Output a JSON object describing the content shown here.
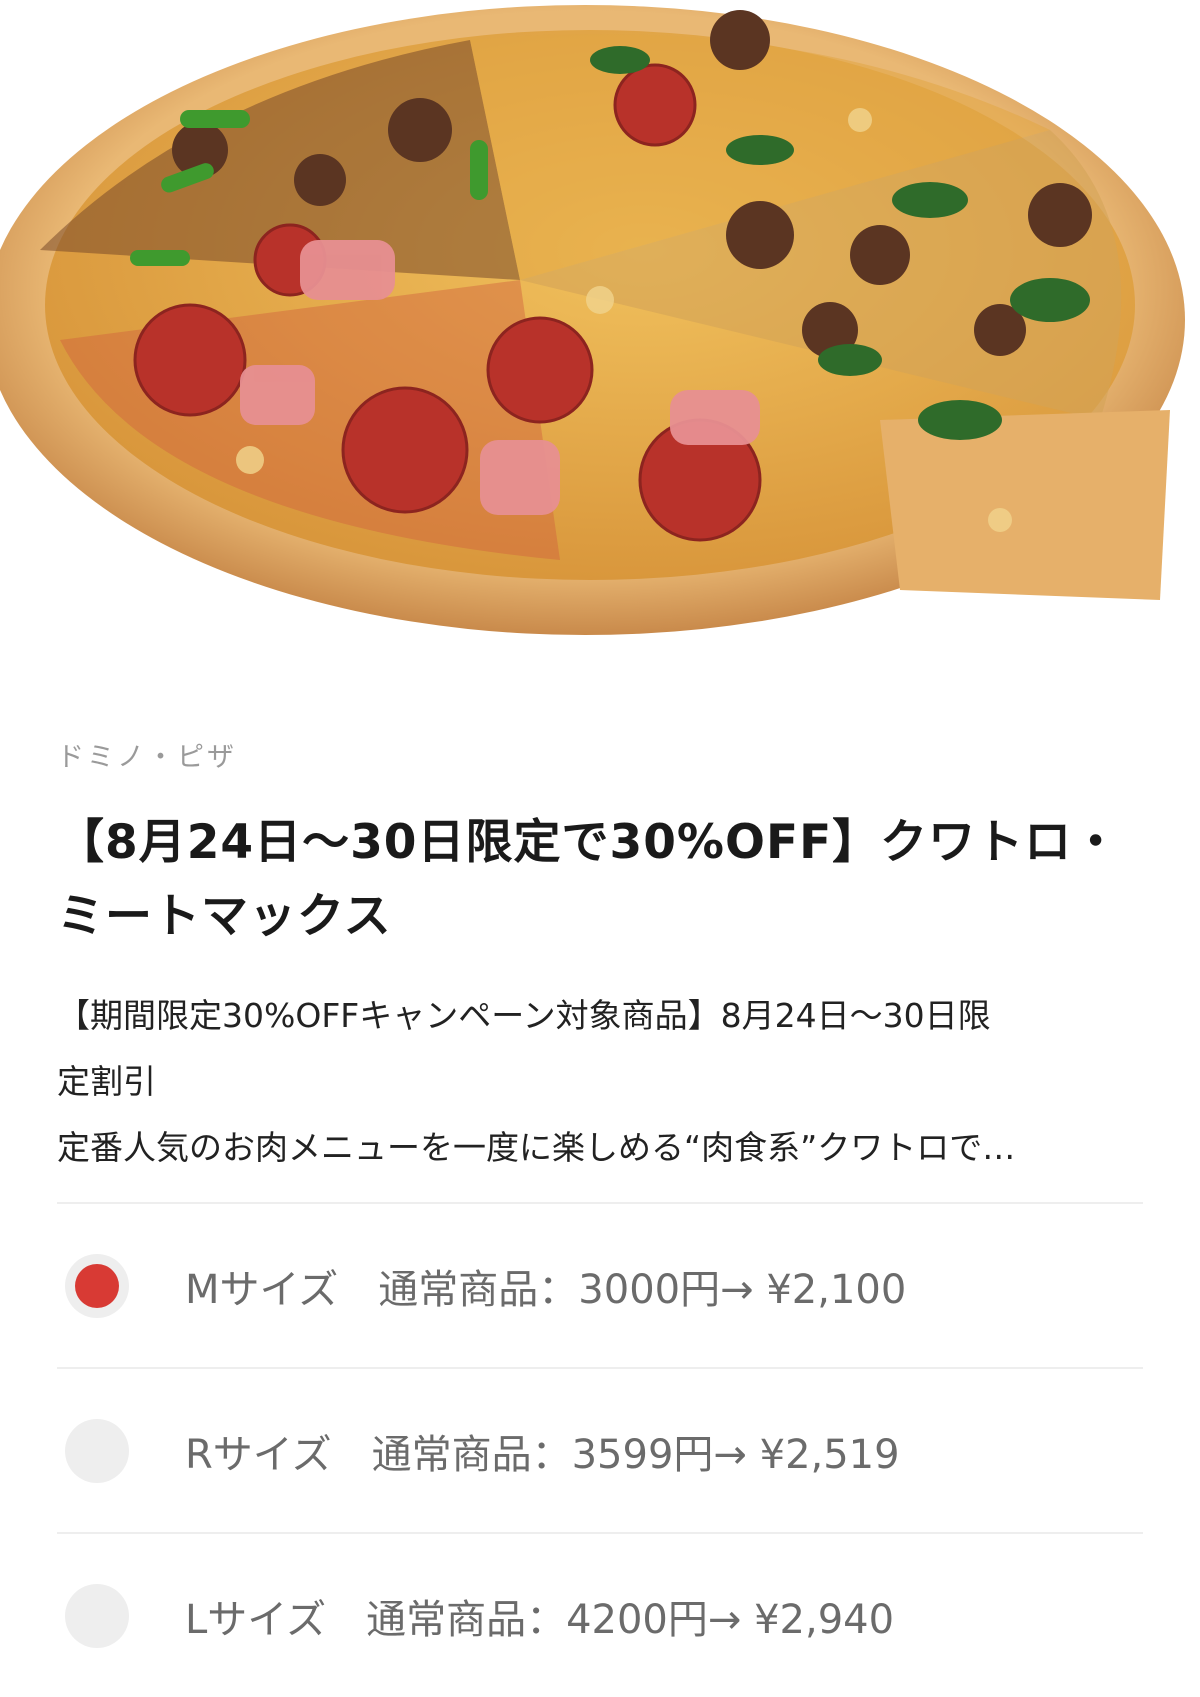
{
  "store": {
    "name": "ドミノ・ピザ"
  },
  "product": {
    "title": "【8月24日〜30日限定で30%OFF】クワトロ・ミートマックス",
    "description_lines": [
      "【期間限定30%OFFキャンペーン対象商品】8月24日〜30日限",
      "定割引",
      "定番人気のお肉メニューを一度に楽しめる“肉食系”クワトロで…"
    ]
  },
  "options": [
    {
      "label": "Mサイズ　通常商品：3000円→ ¥2,100",
      "selected": true
    },
    {
      "label": "Rサイズ　通常商品：3599円→ ¥2,519",
      "selected": false
    },
    {
      "label": "Lサイズ　通常商品：4200円→ ¥2,940",
      "selected": false
    }
  ],
  "colors": {
    "accent": "#d83a34",
    "radio_bg": "#eeeeee",
    "divider": "#eeeeee",
    "muted_text": "#6b6b6b"
  },
  "icons": {
    "radio_selected": "radio-selected-icon",
    "radio_unselected": "radio-unselected-icon"
  }
}
